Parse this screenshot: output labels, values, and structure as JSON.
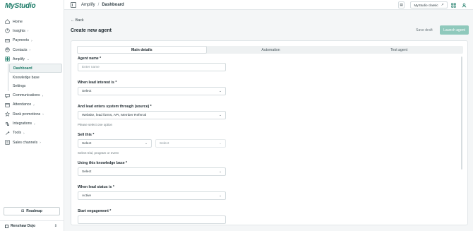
{
  "app": {
    "logo": "MyStudio"
  },
  "sidebar": {
    "items": [
      {
        "label": "Home",
        "icon": "home-icon",
        "chevron": ""
      },
      {
        "label": "Insights",
        "icon": "insights-icon",
        "chevron": "›"
      },
      {
        "label": "Payments",
        "icon": "payments-icon",
        "chevron": "›"
      },
      {
        "label": "Contacts",
        "icon": "contacts-icon",
        "chevron": "›"
      },
      {
        "label": "Amplify",
        "icon": "amplify-icon",
        "chevron": "⌄"
      }
    ],
    "amplify_sub": [
      {
        "label": "Dashboard"
      },
      {
        "label": "Knowledge base"
      },
      {
        "label": "Settings"
      }
    ],
    "items_after": [
      {
        "label": "Communications",
        "icon": "communications-icon",
        "chevron": "›"
      },
      {
        "label": "Attendance",
        "icon": "attendance-icon",
        "chevron": "›"
      },
      {
        "label": "Rank promotions",
        "icon": "rank-icon",
        "chevron": "›"
      },
      {
        "label": "Integrations",
        "icon": "integrations-icon",
        "chevron": "›"
      },
      {
        "label": "Tools",
        "icon": "tools-icon",
        "chevron": "›"
      },
      {
        "label": "Sales channels",
        "icon": "sales-channels-icon",
        "chevron": "›"
      }
    ],
    "roadmap_label": "Roadmap",
    "org_name": "Renshaw Dojo"
  },
  "topbar": {
    "crumb_parent": "Amplify",
    "crumb_sep": "/",
    "crumb_current": "Dashboard",
    "classic_label": "MyStudio classic"
  },
  "main": {
    "back_label": "Back",
    "title": "Create new agent",
    "save_draft_label": "Save draft",
    "launch_label": "Launch agent",
    "tabs": [
      {
        "label": "Main details"
      },
      {
        "label": "Automation"
      },
      {
        "label": "Test agent"
      }
    ],
    "fields": {
      "agent_name": {
        "label": "Agent name *",
        "placeholder": "Enter name"
      },
      "lead_interest": {
        "label": "When lead interest is *",
        "value": "Select"
      },
      "source": {
        "label": "And lead enters system through (source) *",
        "value": "Website, lead forms, API, Member Referral",
        "help": "Please select one option"
      },
      "sell_this": {
        "label": "Sell this *",
        "value": "Select",
        "value2": "Select",
        "help": "Select trial, program or event"
      },
      "knowledge_base": {
        "label": "Using this knowledge base *",
        "value": "Select"
      },
      "lead_status": {
        "label": "When lead status is *",
        "value": "Active"
      },
      "start_engagement": {
        "label": "Start engagement *"
      }
    }
  },
  "colors": {
    "brand": "#1a7a66",
    "launch_bg": "#8fc9bc"
  }
}
